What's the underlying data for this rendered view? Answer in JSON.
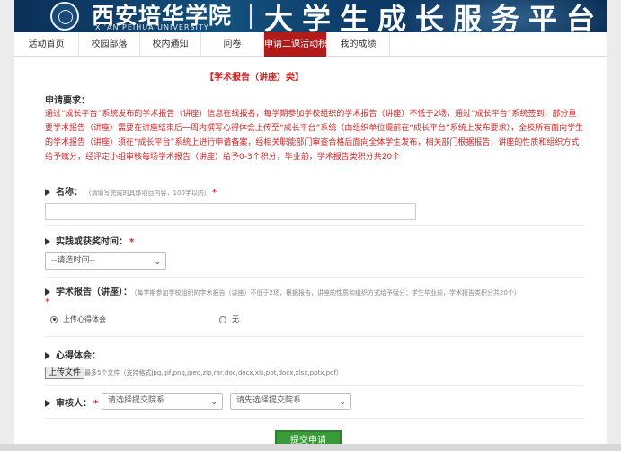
{
  "banner": {
    "school_name": "西安培华学院",
    "school_name_en": "XI'AN PEIHUA UNIVERSITY",
    "platform_title": "大学生成长服务平台"
  },
  "nav": {
    "items": [
      {
        "label": "活动首页",
        "active": false
      },
      {
        "label": "校园部落",
        "active": false
      },
      {
        "label": "校内通知",
        "active": false
      },
      {
        "label": "问卷",
        "active": false
      },
      {
        "label": "申请二课活动积",
        "active": true
      },
      {
        "label": "我的成绩",
        "active": false
      }
    ]
  },
  "form": {
    "title": "【学术报告（讲座）类】",
    "requirements_label": "申请要求：",
    "requirements_text": "通过“成长平台”系统发布的学术报告（讲座）信息在线报名，每学期参加学校组织的学术报告（讲座）不低于2场，通过“成长平台”系统签到，部分重要学术报告（讲座）需要在讲座结束后一周内撰写心得体会上传至“成长平台”系统（由组织单位提前在“成长平台”系统上发布要求），全校所有面向学生的学术报告（讲座）须在“成长平台”系统上进行申请备案，经相关职能部门审查合格后面向全体学生发布，相关部门根据报告，讲座的性质和组织方式给予赋分，经评定小组审核每场学术报告（讲座）给予0-3个积分，毕业前，学术报告类积分共20个",
    "name_label": "名称：",
    "name_hint": "（请填写完成的具体项目内容，100字以内）",
    "time_label": "实践或获奖时间：",
    "time_select": "--请选时间--",
    "report_label": "学术报告（讲座）：",
    "report_hint": "（每学期参加学校组织的学术报告（讲座）不低于2场，根据报告，讲座的性质和组织方式给予赋分；学生毕业前，学术报告类积分共20个）",
    "radio_options": [
      {
        "label": "上传心得体会",
        "checked": true
      },
      {
        "label": "无",
        "checked": false
      }
    ],
    "experience_label": "心得体会：",
    "upload_button": "上传文件",
    "upload_hint": "最多5个文件（支持格式jpg,gif,png,jpeg,zip,rar,doc,docx,xls,ppt,docx,xlsx,pptx,pdf）",
    "reviewer_label": "审核人：",
    "reviewer_select_1": "请选择提交院系",
    "reviewer_select_2": "请先选择提交院系",
    "submit_button": "提交申请",
    "required_mark": "*"
  },
  "colors": {
    "accent_red": "#d12222",
    "nav_active": "#b31b1b",
    "submit_green": "#3a9a3a",
    "banner_blue": "#0d3a67"
  }
}
